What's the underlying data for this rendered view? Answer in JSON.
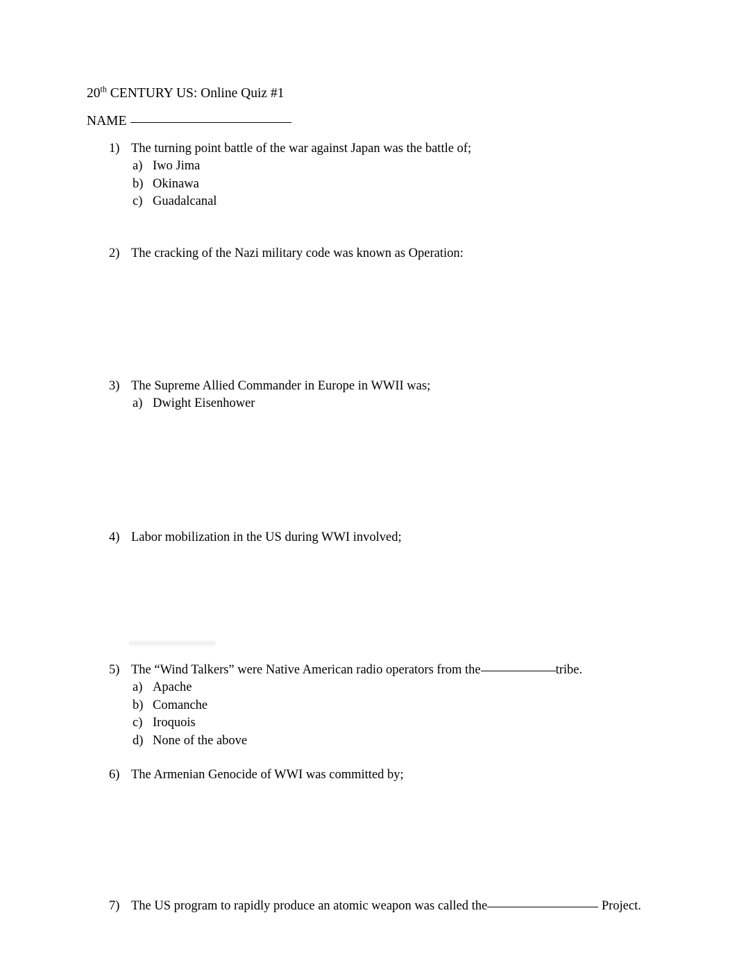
{
  "document": {
    "title_prefix": "20",
    "title_superscript": "th",
    "title_rest": " CENTURY US: Online Quiz #1",
    "name_label": "NAME"
  },
  "questions": [
    {
      "number": "1)",
      "text": "The turning point battle of the war against Japan was the battle of;",
      "options": [
        {
          "letter": "a)",
          "text": "Iwo Jima"
        },
        {
          "letter": "b)",
          "text": "Okinawa"
        },
        {
          "letter": "c)",
          "text": "Guadalcanal"
        }
      ]
    },
    {
      "number": "2)",
      "text": "The cracking of the Nazi military code was known as Operation:",
      "options": []
    },
    {
      "number": "3)",
      "text": "The Supreme Allied Commander in Europe in WWII was;",
      "options": [
        {
          "letter": "a)",
          "text": "Dwight Eisenhower"
        }
      ]
    },
    {
      "number": "4)",
      "text": "Labor mobilization in the US during WWI involved;",
      "options": []
    },
    {
      "number": "5)",
      "text_before_blank": "The “Wind Talkers” were Native American radio operators from the",
      "text_after_blank": "tribe.",
      "options": [
        {
          "letter": "a)",
          "text": "Apache"
        },
        {
          "letter": "b)",
          "text": "Comanche"
        },
        {
          "letter": "c)",
          "text": "Iroquois"
        },
        {
          "letter": "d)",
          "text": "None of the above"
        }
      ]
    },
    {
      "number": "6)",
      "text": "The Armenian Genocide of WWI was committed by;",
      "options": []
    },
    {
      "number": "7)",
      "text_before_blank": "The US program to rapidly produce an atomic weapon was called the",
      "text_after_blank": "Project.",
      "options": []
    }
  ]
}
